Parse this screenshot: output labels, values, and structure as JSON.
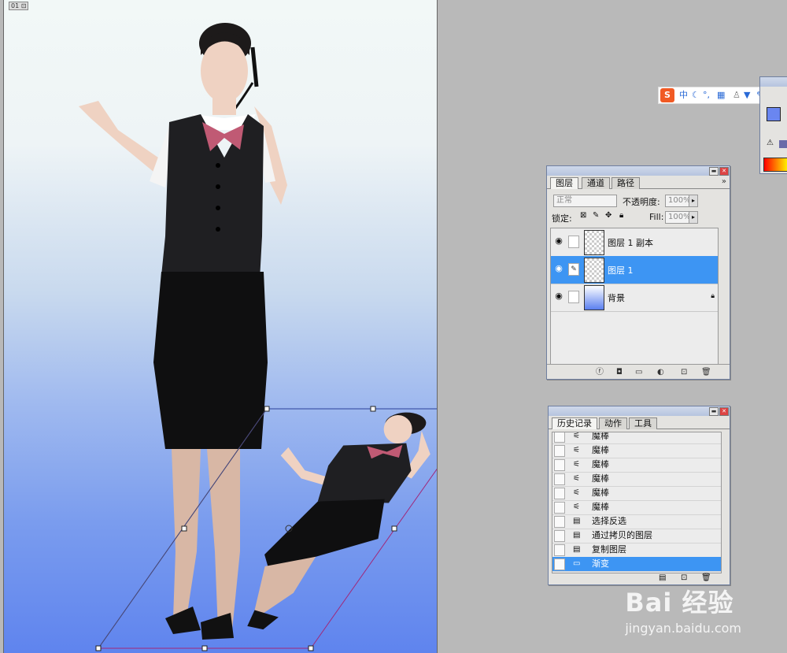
{
  "document": {
    "badge": "01 ⊡"
  },
  "layers_panel": {
    "tabs": [
      "图层",
      "通道",
      "路径"
    ],
    "blend_mode": "正常",
    "opacity_label": "不透明度:",
    "opacity_value": "100%",
    "lock_label": "锁定:",
    "fill_label": "Fill:",
    "fill_value": "100%",
    "layers": [
      {
        "name": "图层 1 副本",
        "selected": false
      },
      {
        "name": "图层 1",
        "selected": true
      },
      {
        "name": "背景",
        "selected": false
      }
    ]
  },
  "history_panel": {
    "tabs": [
      "历史记录",
      "动作",
      "工具"
    ],
    "items": [
      {
        "label": "魔棒",
        "icon": "magic-wand-icon"
      },
      {
        "label": "魔棒",
        "icon": "magic-wand-icon"
      },
      {
        "label": "魔棒",
        "icon": "magic-wand-icon"
      },
      {
        "label": "魔棒",
        "icon": "magic-wand-icon"
      },
      {
        "label": "魔棒",
        "icon": "magic-wand-icon"
      },
      {
        "label": "魔棒",
        "icon": "magic-wand-icon"
      },
      {
        "label": "选择反选",
        "icon": "document-icon"
      },
      {
        "label": "通过拷贝的图层",
        "icon": "document-icon"
      },
      {
        "label": "复制图层",
        "icon": "document-icon"
      },
      {
        "label": "渐变",
        "icon": "gradient-icon"
      }
    ]
  },
  "ime_toolbar": {
    "logo": "S",
    "mode": "中"
  },
  "watermark": {
    "brand": "Bai 经验",
    "url": "jingyan.baidu.com"
  },
  "colors": {
    "selection": "#3d95f3",
    "canvas_bottom": "#5f84ee",
    "workspace": "#b9b9b9"
  }
}
